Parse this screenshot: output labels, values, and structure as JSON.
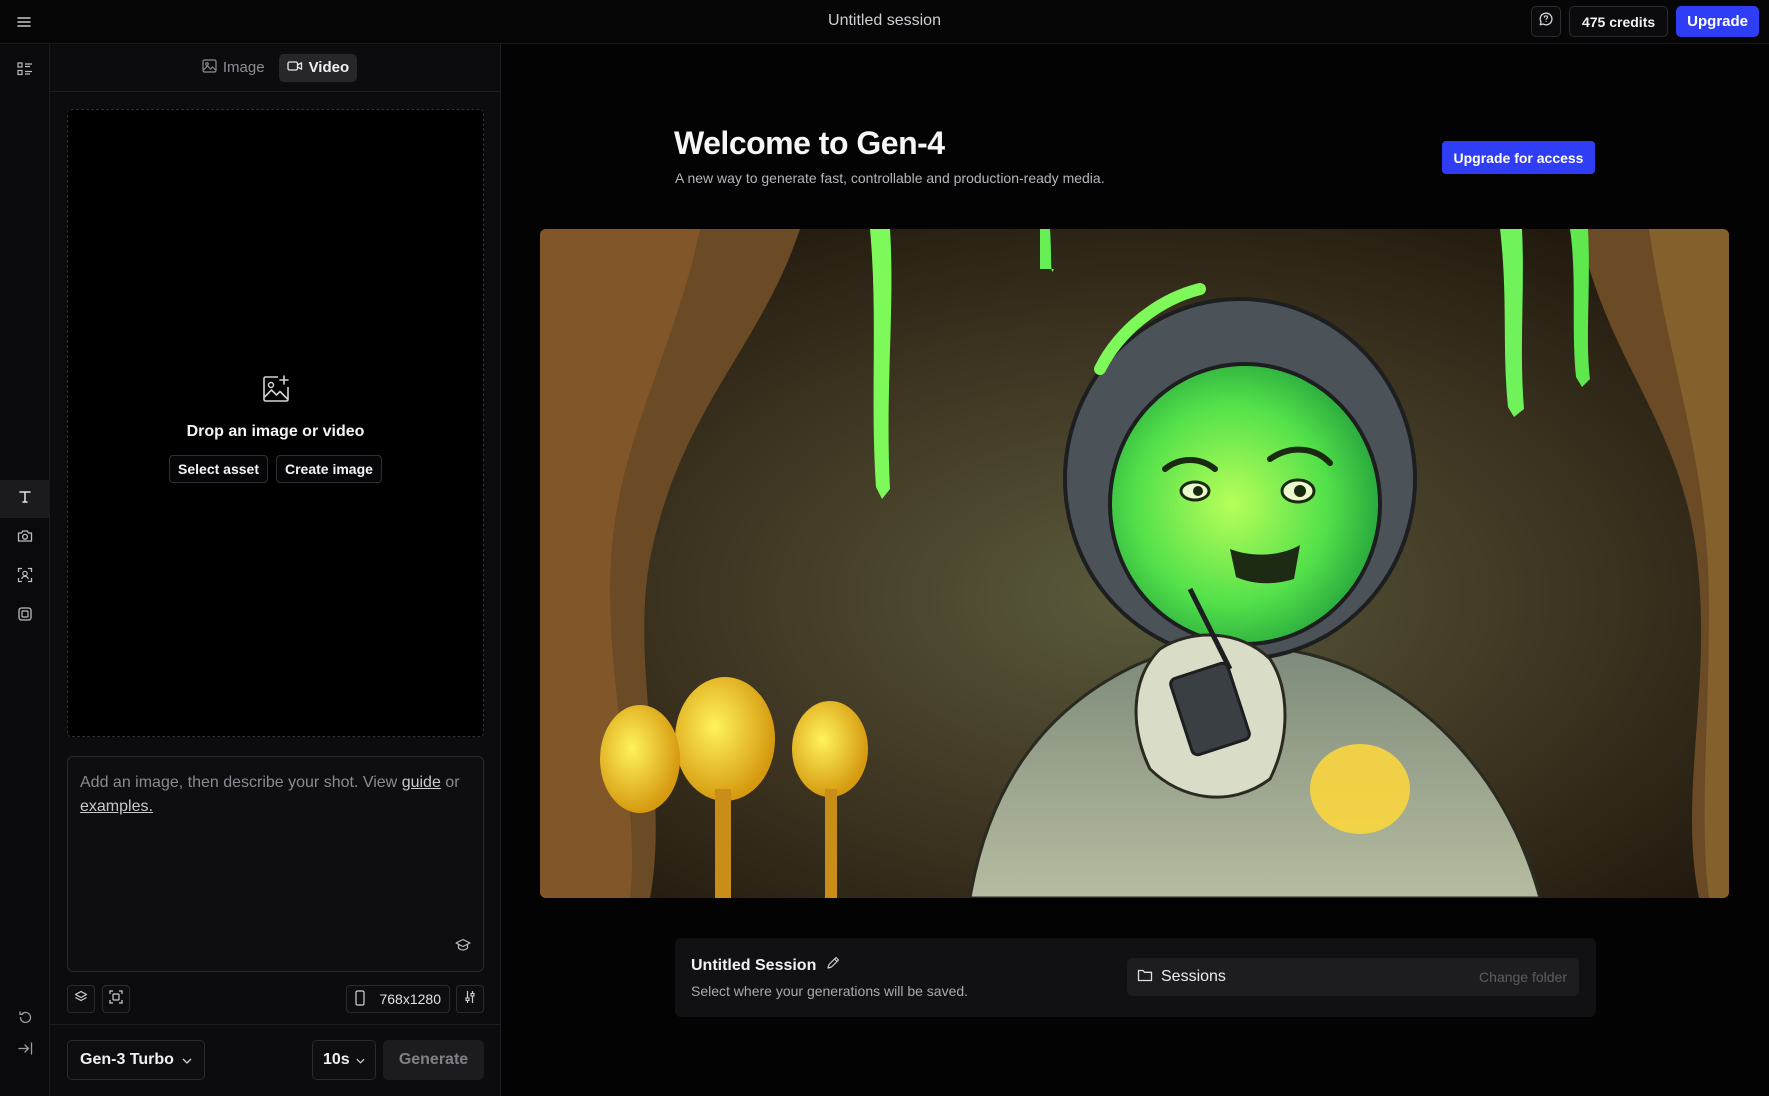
{
  "header": {
    "session_title": "Untitled session",
    "credits_label": "475 credits",
    "upgrade_label": "Upgrade"
  },
  "mode_tabs": [
    {
      "label": "Image",
      "icon": "image-icon",
      "active": false
    },
    {
      "label": "Video",
      "icon": "video-camera-icon",
      "active": true
    }
  ],
  "rail": {
    "items": [
      "text-icon",
      "camera-icon",
      "face-scan-icon",
      "frames-icon"
    ],
    "active_index": 0
  },
  "dropzone": {
    "title": "Drop an image or video",
    "select_asset_label": "Select asset",
    "create_image_label": "Create image"
  },
  "prompt": {
    "placeholder_start": "Add an image, then describe your shot. View",
    "guide_link": "guide",
    "or_text": "or",
    "examples_link": "examples."
  },
  "toolbar": {
    "resolution": "768x1280"
  },
  "footer": {
    "model_label": "Gen-3 Turbo",
    "duration_label": "10s",
    "generate_label": "Generate"
  },
  "welcome": {
    "title": "Welcome to Gen-4",
    "subtitle": "A new way to generate fast, controllable and production-ready media.",
    "cta_label": "Upgrade for access"
  },
  "session_card": {
    "title": "Untitled Session",
    "subtitle": "Select where your generations will be saved.",
    "folder_name": "Sessions",
    "change_folder_label": "Change folder"
  },
  "colors": {
    "accent": "#2f3ef5",
    "background": "#030303",
    "panel": "#0c0c0f"
  }
}
